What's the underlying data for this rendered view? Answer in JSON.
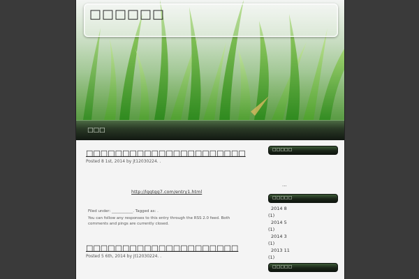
{
  "site": {
    "title": "□□□□□□"
  },
  "nav": {
    "home_label": "□□□"
  },
  "posts": [
    {
      "title": "□□□□□□□□□□□□□□□□□□□□□□",
      "meta": "Posted 8    1st, 2014 by jt12030224.                                              .",
      "link": "http://lggtgg7.com/entry1.html",
      "filed": "Filed under: ___________. Tagged as: .",
      "responses": "You can follow any responses to this entry through the RSS 2.0 feed. Both comments and pings are currently closed."
    },
    {
      "title": "□□□□□□□□□□□□□□□□□□□□□",
      "meta": "Posted 5    6th, 2014 by jt12030224.                                              ."
    }
  ],
  "sidebar": {
    "widget1_title": "□□□□□",
    "widget1_dots": "...",
    "widget2_title": "□□□□□",
    "archives": [
      {
        "month": "2014 8",
        "count": "(1)"
      },
      {
        "month": "2014 5",
        "count": "(1)"
      },
      {
        "month": "2014 3",
        "count": "(1)"
      },
      {
        "month": "2013 11",
        "count": "(1)"
      }
    ],
    "widget3_title": "□□□□□"
  },
  "colors": {
    "page_bg": "#3a3a3a",
    "content_bg": "#f4f4f4",
    "accent_green": "#2f4a2a"
  }
}
